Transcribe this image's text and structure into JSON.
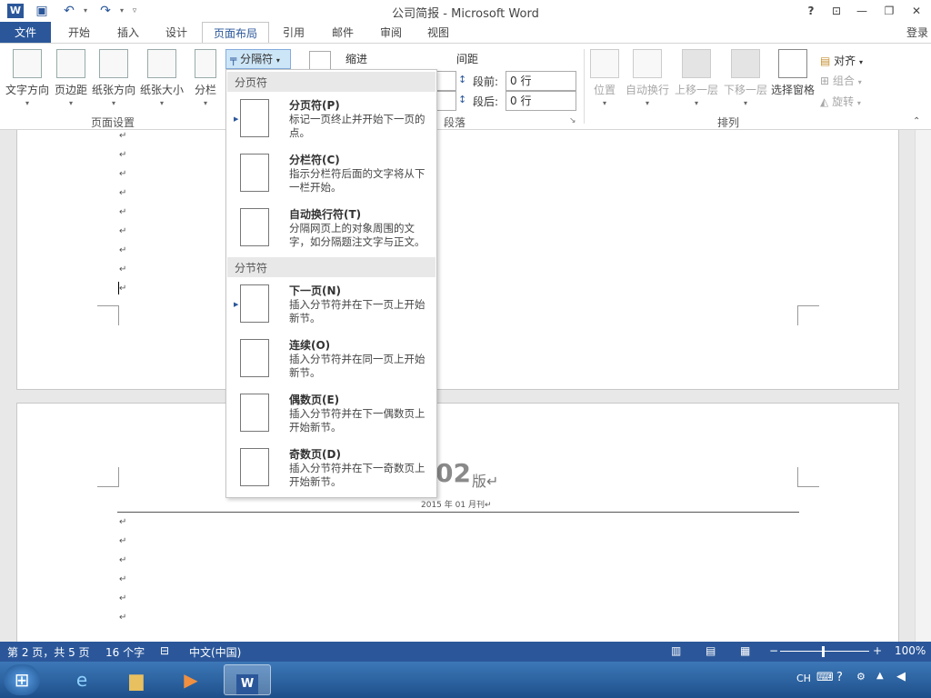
{
  "window": {
    "title": "公司简报 - Microsoft Word",
    "help": "?",
    "login": "登录"
  },
  "tabs": [
    {
      "label": "文件"
    },
    {
      "label": "开始"
    },
    {
      "label": "插入"
    },
    {
      "label": "设计"
    },
    {
      "label": "页面布局"
    },
    {
      "label": "引用"
    },
    {
      "label": "邮件"
    },
    {
      "label": "审阅"
    },
    {
      "label": "视图"
    }
  ],
  "ribbon": {
    "page_setup": {
      "label": "页面设置",
      "text_direction": "文字方向",
      "margins": "页边距",
      "orientation": "纸张方向",
      "size": "纸张大小",
      "columns": "分栏",
      "breaks": "分隔符"
    },
    "paragraph": {
      "label": "段落",
      "indent": "缩进",
      "spacing": "间距",
      "before_label": "段前:",
      "before_value": "0 行",
      "after_label": "段后:",
      "after_value": "0 行"
    },
    "arrange": {
      "label": "排列",
      "position": "位置",
      "wrap": "自动换行",
      "forward": "上移一层",
      "backward": "下移一层",
      "selection_pane": "选择窗格",
      "align": "对齐",
      "group": "组合",
      "rotate": "旋转"
    }
  },
  "menu": {
    "page_breaks_header": "分页符",
    "section_breaks_header": "分节符",
    "items": [
      {
        "title": "分页符(P)",
        "desc": "标记一页终止并开始下一页的点。"
      },
      {
        "title": "分栏符(C)",
        "desc": "指示分栏符后面的文字将从下一栏开始。"
      },
      {
        "title": "自动换行符(T)",
        "desc": "分隔网页上的对象周围的文字，如分隔题注文字与正文。"
      },
      {
        "title": "下一页(N)",
        "desc": "插入分节符并在下一页上开始新节。"
      },
      {
        "title": "连续(O)",
        "desc": "插入分节符并在同一页上开始新节。"
      },
      {
        "title": "偶数页(E)",
        "desc": "插入分节符并在下一偶数页上开始新节。"
      },
      {
        "title": "奇数页(D)",
        "desc": "插入分节符并在下一奇数页上开始新节。"
      }
    ]
  },
  "document": {
    "para_mark": "↵",
    "heading_frag": "02",
    "heading_suffix": "版↵",
    "date_line": "2015 年 01 月刊↵"
  },
  "status": {
    "page": "第 2 页，共 5 页",
    "words": "16 个字",
    "lang": "中文(中国)",
    "zoom": "100%"
  },
  "taskbar": {
    "lang": "CH"
  },
  "colors": {
    "accent": "#2b579a"
  }
}
